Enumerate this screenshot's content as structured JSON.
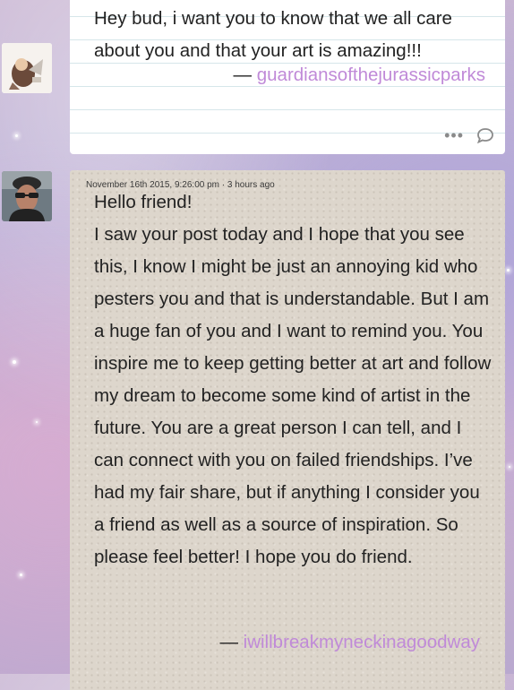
{
  "post1": {
    "message": "Hey bud, i want you to know that we all care about you and that your art is amazing!!!",
    "dash": "—",
    "author": "guardiansofthejurassicparks",
    "more_icon": "ellipsis-icon",
    "reply_icon": "reply-bubble-icon"
  },
  "post2": {
    "timestamp": "November 16th 2015, 9:26:00 pm · 3 hours ago",
    "greeting": "Hello friend!",
    "message": "I saw your post today and I hope that you see this, I know I might be just an annoying kid who pesters you and that is understandable. But I am a huge fan of you and I want to remind you. You inspire me to keep getting better at art and follow my dream to become some kind of artist in the future. You are a great person I can tell, and I can connect with you on failed friendships. I’ve had my fair share, but if anything I consider you a friend as well as a source of inspiration. So please feel better! I hope you do friend.",
    "dash": "—",
    "author": "iwillbreakmyneckinagoodway"
  },
  "colors": {
    "link": "#c08ad8",
    "paper": "#ddd6cc",
    "lined_paper": "#ffffff"
  }
}
